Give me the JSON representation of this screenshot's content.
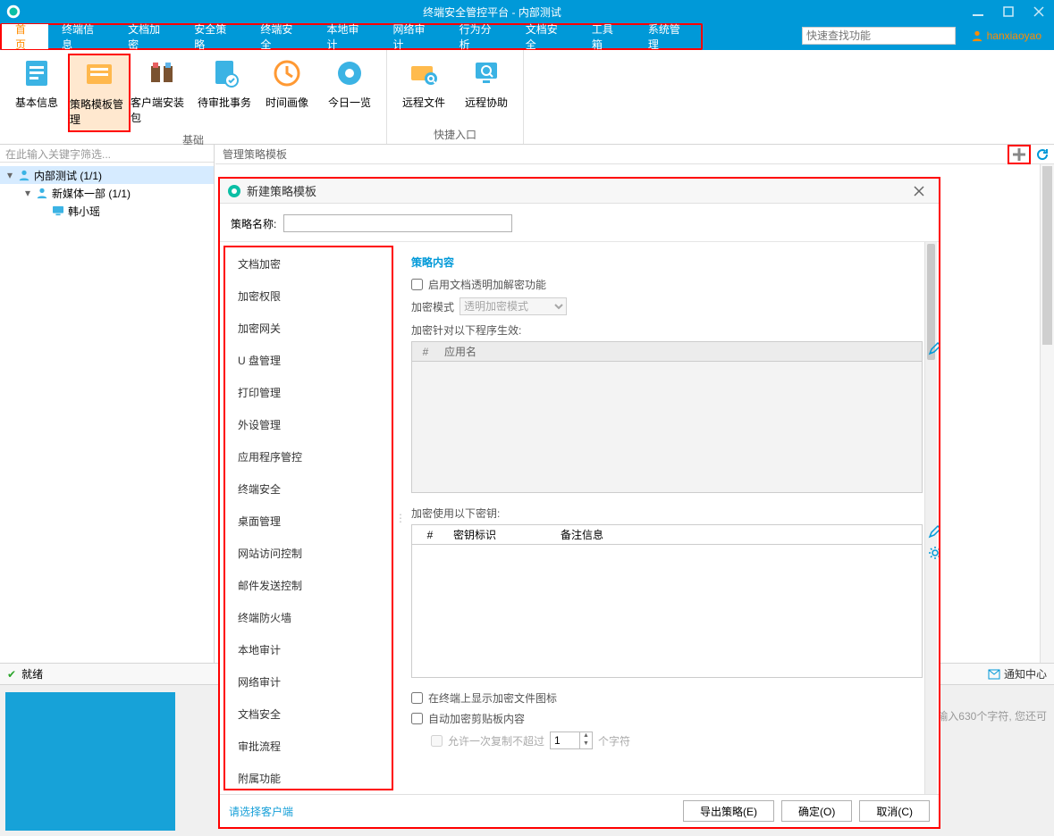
{
  "window": {
    "title": "终端安全管控平台 - 内部测试"
  },
  "search_placeholder": "快速查找功能",
  "user": "hanxiaoyao",
  "menu": [
    "首页",
    "终端信息",
    "文档加密",
    "安全策略",
    "终端安全",
    "本地审计",
    "网络审计",
    "行为分析",
    "文档安全",
    "工具箱",
    "系统管理"
  ],
  "ribbon": {
    "group1": {
      "caption": "基础",
      "items": [
        "基本信息",
        "策略模板管理",
        "客户端安装包",
        "待审批事务",
        "时间画像",
        "今日一览"
      ]
    },
    "group2": {
      "caption": "快捷入口",
      "items": [
        "远程文件",
        "远程协助"
      ]
    }
  },
  "tree_filter_placeholder": "在此输入关键字筛选...",
  "tree": {
    "root": "内部测试 (1/1)",
    "child": "新媒体一部 (1/1)",
    "leaf": "韩小瑶"
  },
  "right_header": "管理策略模板",
  "status_ready": "就绪",
  "notif": "通知中心",
  "bottom_hint": "输入630个字符, 您还可",
  "dialog": {
    "title": "新建策略模板",
    "name_label": "策略名称:",
    "left_items": [
      "文档加密",
      "加密权限",
      "加密网关",
      "U 盘管理",
      "打印管理",
      "外设管理",
      "应用程序管控",
      "终端安全",
      "桌面管理",
      "网站访问控制",
      "邮件发送控制",
      "终端防火墙",
      "本地审计",
      "网络审计",
      "文档安全",
      "审批流程",
      "附属功能"
    ],
    "content_title": "策略内容",
    "chk_enable": "启用文档透明加解密功能",
    "mode_label": "加密模式",
    "mode_value": "透明加密模式",
    "apply_label": "加密针对以下程序生效:",
    "app_col_hash": "#",
    "app_col_name": "应用名",
    "key_label": "加密使用以下密钥:",
    "key_col_hash": "#",
    "key_col_id": "密钥标识",
    "key_col_note": "备注信息",
    "chk_show": "在终端上显示加密文件图标",
    "chk_clip": "自动加密剪贴板内容",
    "clip_limit_pre": "允许一次复制不超过",
    "clip_limit_val": "1",
    "clip_limit_post": "个字符",
    "hint": "请选择客户端",
    "btn_export": "导出策略(E)",
    "btn_ok": "确定(O)",
    "btn_cancel": "取消(C)"
  }
}
